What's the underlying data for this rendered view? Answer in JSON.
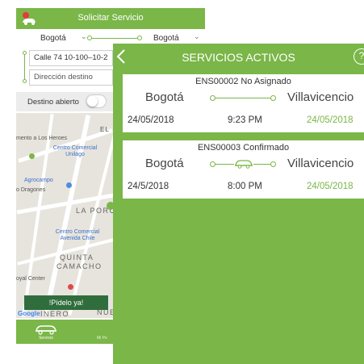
{
  "background_screen": {
    "header": {
      "title": "Solicitar Servicio",
      "logo_icon": "car-logo-icon"
    },
    "city_selector": {
      "origin_city": "Bogotá",
      "destination_city": "Bogotá",
      "chevron": "⌄"
    },
    "address": {
      "origin": "Calle 74 10-100–10-2",
      "destination": "Dirección destino"
    },
    "open_destination": {
      "label": "Destino abierto",
      "enabled": false
    },
    "map": {
      "labels": {
        "heroes": "mento a Los Heroes",
        "cc_unilago": "Centro Comercial Unilago",
        "agrocampo": "Agrocampo",
        "dragones": "o Dragones",
        "la_porc": "LA PORC",
        "cc_chile": "Centro Comercial Avenida Chile",
        "quinta": "QUINTA",
        "camacho": "CAMACHO",
        "royal": "oyal Center",
        "el": "EL",
        "nue": "NUE",
        "inero": "INERO"
      },
      "google": "Google",
      "order_button": "!Pídelo ya!"
    },
    "bottom_tabs": {
      "service_label": "Servicio",
      "second_label": "Mi Pe"
    }
  },
  "overlay": {
    "title": "SERVICIOS ACTIVOS",
    "help": "?",
    "services": [
      {
        "code": "ENS00002 No Asignado",
        "origin": "Bogotá",
        "destination": "Villavicencio",
        "date": "24/05/2018",
        "time": "9:23 PM",
        "arrival_date": "24/05/2018",
        "car_on_route": false
      },
      {
        "code": "ENS00003 Confirmado",
        "origin": "Bogotá",
        "destination": "Villavicencio",
        "date": "24/5/2018",
        "time": "8:00 PM",
        "arrival_date": "24/05/2018",
        "car_on_route": true
      }
    ]
  },
  "colors": {
    "brand_green": "#7ab648",
    "dark_green": "#2f6d3c",
    "white": "#ffffff"
  }
}
